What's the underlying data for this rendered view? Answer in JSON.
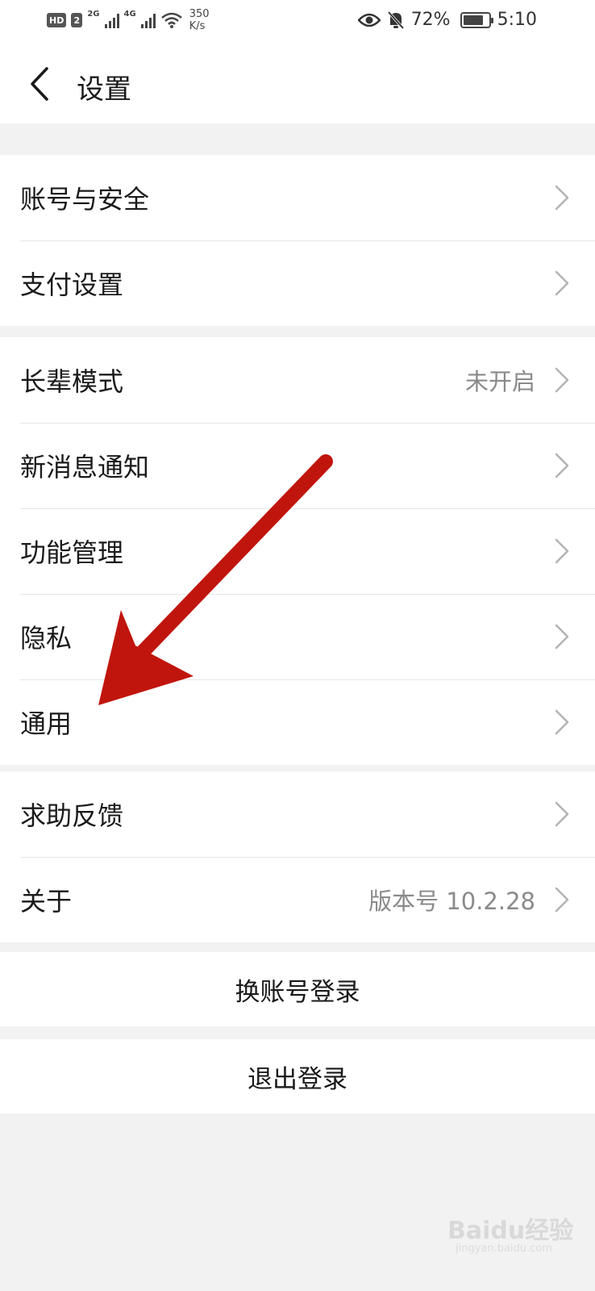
{
  "status_bar": {
    "hd1": "HD",
    "hd2": "2",
    "net1": "2G",
    "net2": "4G",
    "speed_value": "350",
    "speed_unit": "K/s",
    "battery": "72%",
    "time": "5:10"
  },
  "header": {
    "title": "设置"
  },
  "groups": [
    {
      "items": [
        {
          "label": "账号与安全",
          "value": ""
        },
        {
          "label": "支付设置",
          "value": ""
        }
      ]
    },
    {
      "items": [
        {
          "label": "长辈模式",
          "value": "未开启"
        },
        {
          "label": "新消息通知",
          "value": ""
        },
        {
          "label": "功能管理",
          "value": ""
        },
        {
          "label": "隐私",
          "value": ""
        },
        {
          "label": "通用",
          "value": ""
        }
      ]
    },
    {
      "items": [
        {
          "label": "求助反馈",
          "value": ""
        },
        {
          "label": "关于",
          "value": "版本号 10.2.28"
        }
      ]
    }
  ],
  "actions": {
    "switch_account": "换账号登录",
    "logout": "退出登录"
  },
  "annotation": {
    "arrow_color": "#c0150d"
  },
  "watermark": {
    "brand": "Baidu经验",
    "site": "jingyan.baidu.com"
  }
}
